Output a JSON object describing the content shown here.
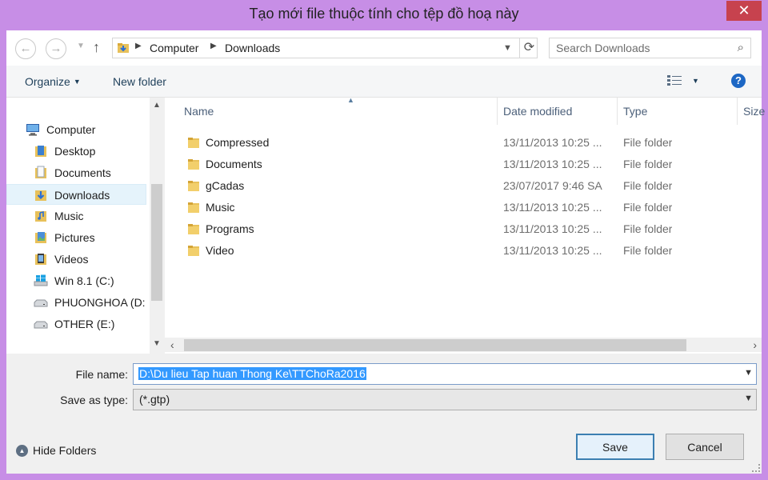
{
  "window": {
    "title": "Tạo mới file thuộc tính cho tệp đồ hoạ này",
    "close_glyph": "✕"
  },
  "address": {
    "crumbs": [
      "Computer",
      "Downloads"
    ],
    "back_glyph": "←",
    "forward_glyph": "→",
    "up_glyph": "↑",
    "refresh_glyph": "⟳",
    "search_placeholder": "Search Downloads"
  },
  "toolbar": {
    "organize": "Organize",
    "new_folder": "New folder",
    "help_glyph": "?"
  },
  "nav": {
    "items": [
      {
        "label": "Computer",
        "icon": "computer-icon"
      },
      {
        "label": "Desktop",
        "icon": "desktop-folder-icon"
      },
      {
        "label": "Documents",
        "icon": "documents-folder-icon"
      },
      {
        "label": "Downloads",
        "icon": "downloads-folder-icon",
        "selected": true
      },
      {
        "label": "Music",
        "icon": "music-folder-icon"
      },
      {
        "label": "Pictures",
        "icon": "pictures-folder-icon"
      },
      {
        "label": "Videos",
        "icon": "videos-folder-icon"
      },
      {
        "label": "Win 8.1  (C:)",
        "icon": "windows-drive-icon"
      },
      {
        "label": "PHUONGHOA (D:",
        "icon": "drive-icon"
      },
      {
        "label": "OTHER (E:)",
        "icon": "drive-icon"
      }
    ]
  },
  "columns": {
    "name": "Name",
    "date": "Date modified",
    "type": "Type",
    "size": "Size"
  },
  "files": [
    {
      "name": "Compressed",
      "date": "13/11/2013 10:25 ...",
      "type": "File folder"
    },
    {
      "name": "Documents",
      "date": "13/11/2013 10:25 ...",
      "type": "File folder"
    },
    {
      "name": "gCadas",
      "date": "23/07/2017 9:46 SA",
      "type": "File folder"
    },
    {
      "name": "Music",
      "date": "13/11/2013 10:25 ...",
      "type": "File folder"
    },
    {
      "name": "Programs",
      "date": "13/11/2013 10:25 ...",
      "type": "File folder"
    },
    {
      "name": "Video",
      "date": "13/11/2013 10:25 ...",
      "type": "File folder"
    }
  ],
  "form": {
    "file_name_label": "File name:",
    "file_name_value": "D:\\Du lieu Tap huan Thong Ke\\TTChoRa2016",
    "save_type_label": "Save as type:",
    "save_type_value": "(*.gtp)"
  },
  "footer": {
    "hide_folders": "Hide Folders",
    "save": "Save",
    "cancel": "Cancel"
  },
  "colors": {
    "frame": "#c78ee6",
    "close": "#c7424e",
    "selection": "#3399ff",
    "accent": "#3c7fb1"
  }
}
